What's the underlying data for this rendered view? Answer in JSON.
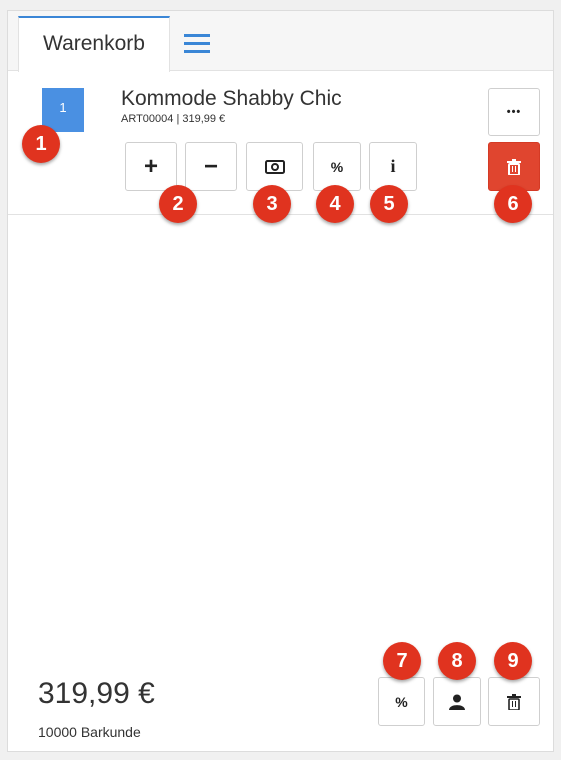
{
  "tabs": {
    "active_label": "Warenkorb"
  },
  "cart_item": {
    "quantity": "1",
    "name": "Kommode Shabby Chic",
    "meta": "ART00004 | 319,99 €",
    "more_label": "•••",
    "plus_label": "+",
    "minus_label": "−",
    "percent_label": "%",
    "info_label": "i"
  },
  "summary": {
    "total": "319,99 €",
    "customer": "10000 Barkunde",
    "percent_label": "%"
  },
  "markers": [
    "1",
    "2",
    "3",
    "4",
    "5",
    "6",
    "7",
    "8",
    "9"
  ],
  "colors": {
    "accent": "#3a86d6",
    "badge": "#4a90e2",
    "delete": "#e0452f",
    "marker": "#e0331f"
  },
  "icons": {
    "menu": "hamburger-icon",
    "price": "banknote-icon",
    "user": "user-icon",
    "delete": "trash-icon"
  }
}
